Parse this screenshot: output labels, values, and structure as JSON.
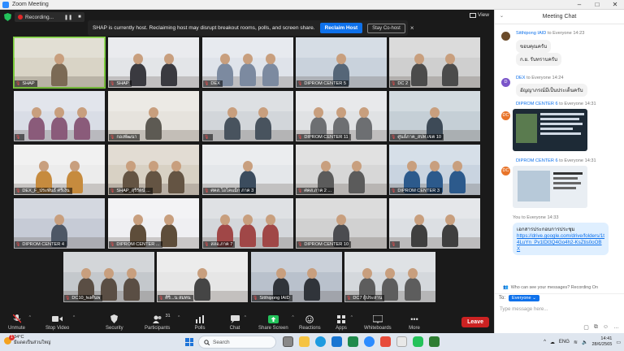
{
  "window": {
    "title": "Zoom Meeting",
    "controls": [
      "–",
      "□",
      "✕"
    ]
  },
  "topbar": {
    "recording_label": "Recording...",
    "view_label": "View"
  },
  "host_banner": {
    "message": "SHAP is currently host. Reclaiming host may disrupt breakout rooms, polls, and screen share.",
    "reclaim_label": "Reclaim Host",
    "stay_label": "Stay Co-host"
  },
  "tiles": [
    {
      "name": "SHAP"
    },
    {
      "name": "SHAP"
    },
    {
      "name": "DEX"
    },
    {
      "name": "DIPROM CENTER 5"
    },
    {
      "name": "DC 2"
    },
    {
      "name": ""
    },
    {
      "name": "กองพัฒนา"
    },
    {
      "name": ""
    },
    {
      "name": "DIPROM CENTER 11"
    },
    {
      "name": "ศูนย์ภาค_สปท.เขต 10"
    },
    {
      "name": "DEX_F_ประพันธ์ ศรีเงิน"
    },
    {
      "name": "SHAP_สุรีรัตน์ ..."
    },
    {
      "name": "ศคส.โอโคแม็ก ภาค 3"
    },
    {
      "name": "ศคส.ภาค 2 ..."
    },
    {
      "name": "DIPROM CENTER 3"
    },
    {
      "name": "DIPROM CENTER 4"
    },
    {
      "name": "DIPROM CENTER ..."
    },
    {
      "name": "สสอ.ภาค 7"
    },
    {
      "name": "DIPROM CENTER 10"
    },
    {
      "name": ""
    },
    {
      "name": "DC10_พงศ์นพ"
    },
    {
      "name": "ศิริ...น สมทน"
    },
    {
      "name": "Sitthipong IAID"
    },
    {
      "name": "DC7 ผู้ประสาน"
    }
  ],
  "toolbar": {
    "unmute": "Unmute",
    "stop_video": "Stop Video",
    "security": "Security",
    "participants": "Participants",
    "participants_count": "31",
    "polls": "Polls",
    "chat": "Chat",
    "share_screen": "Share Screen",
    "reactions": "Reactions",
    "apps": "Apps",
    "whiteboards": "Whiteboards",
    "more": "More",
    "leave": "Leave"
  },
  "chat": {
    "title": "Meeting Chat",
    "messages": [
      {
        "sender": "Sitthipong IAID",
        "to": "to Everyone",
        "time": "14:23",
        "lines": [
          "ขอบคุณครับ",
          "ก.ย. รับทราบครับ"
        ]
      },
      {
        "sender": "DEX",
        "to": "to Everyone",
        "time": "14:24",
        "lines": [
          "อัญญาภรณ์มีเป็นประเด็นครับ"
        ]
      },
      {
        "sender": "DIPROM CENTER 6",
        "to": "to Everyone",
        "time": "14:31"
      },
      {
        "sender": "DIPROM CENTER 6",
        "to": "to Everyone",
        "time": "14:31"
      },
      {
        "sender": "You",
        "to": "to Everyone",
        "time": "14:33",
        "text": "เอกสารประกอบการประชุม",
        "link": "https://drive.google.com/drive/folders/1t4LuYn_Pv1lDl3Q4Go4h2-KsZtis0oOBX"
      }
    ],
    "who_can_see": "Who can see your messages? Recording On",
    "to_label": "To:",
    "recipient": "Everyone",
    "input_placeholder": "Type message here..."
  },
  "taskbar": {
    "weather_temp": "34°C",
    "weather_desc": "มีแดดเป็นส่วนใหญ่",
    "notification_count": "1",
    "search_placeholder": "Search",
    "lang": "ENG",
    "time": "14:41",
    "date": "28/6/2565"
  }
}
